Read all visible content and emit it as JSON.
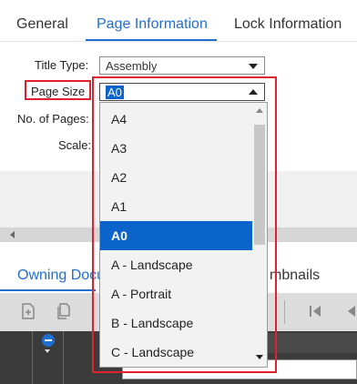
{
  "tabs": {
    "general": "General",
    "page_information": "Page Information",
    "lock_information": "Lock Information"
  },
  "form": {
    "title_type_label": "Title Type:",
    "title_type_value": "Assembly",
    "page_size_label": "Page Size",
    "page_size_value": "A0",
    "no_of_pages_label": "No. of Pages:",
    "scale_label": "Scale:"
  },
  "dropdown": {
    "options": [
      "A4",
      "A3",
      "A2",
      "A1",
      "A0",
      "A - Landscape",
      "A - Portrait",
      "B - Landscape",
      "C - Landscape"
    ],
    "selected": "A0"
  },
  "bottom_tabs": {
    "owning_documents": "Owning Docu",
    "thumbnails": "mbnails"
  },
  "colors": {
    "accent": "#1f6fd0",
    "selection": "#0a64c9",
    "annotation": "#e0202c"
  }
}
